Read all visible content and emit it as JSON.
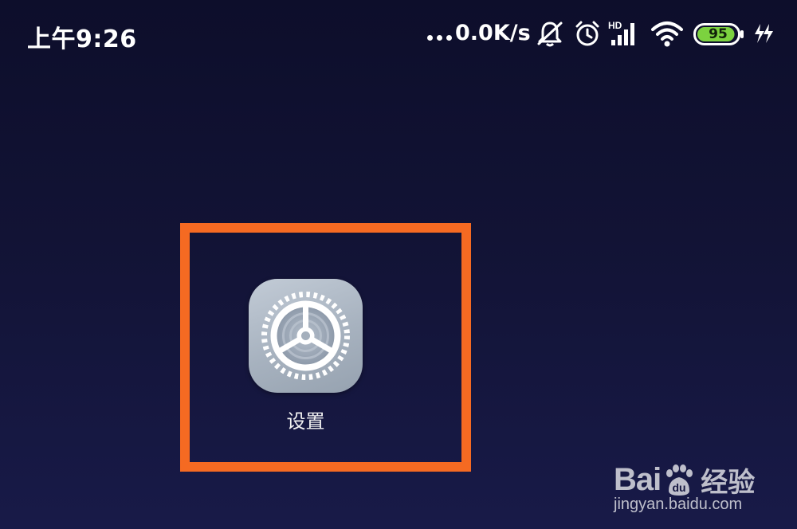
{
  "status_bar": {
    "time": "上午9:26",
    "network_speed": "0.0K/s",
    "network_type_label": "HD",
    "battery_level": "95",
    "battery_percent": 95,
    "icons": [
      "more-dots-icon",
      "mute-bell-icon",
      "alarm-clock-icon",
      "signal-bars-icon",
      "wifi-icon",
      "battery-icon",
      "charging-icon"
    ]
  },
  "home_screen": {
    "app": {
      "label": "设置",
      "icon": "gear-icon"
    }
  },
  "watermark": {
    "logo_left": "Bai",
    "logo_right": "经验",
    "logo_glyph": "du",
    "url": "jingyan.baidu.com"
  },
  "colors": {
    "background": "#121335",
    "highlight": "#f56a22",
    "tile": "#a7b2bf",
    "battery_fill": "#7cd23f"
  }
}
